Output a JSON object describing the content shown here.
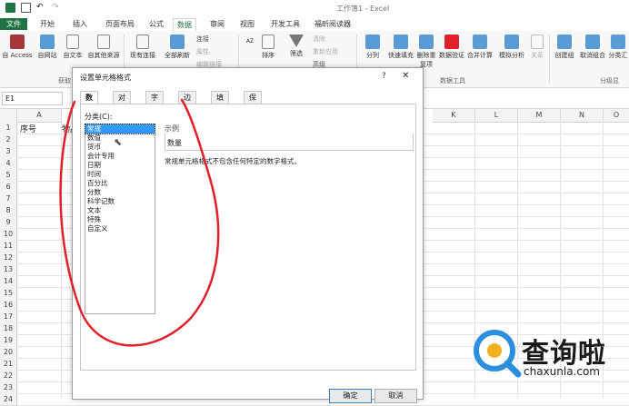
{
  "window": {
    "title": "工作簿1 - Excel"
  },
  "tabs": {
    "file": "文件",
    "items": [
      "开始",
      "插入",
      "页面布局",
      "公式",
      "数据",
      "审阅",
      "视图",
      "开发工具",
      "福昕阅读器"
    ],
    "active": "数据"
  },
  "ribbon": {
    "buttons": [
      "自 Access",
      "自网站",
      "自文本",
      "自其他来源",
      "现有连接",
      "全部刷新",
      "排序",
      "筛选",
      "分列",
      "快速填充",
      "删除重复项",
      "数据验证",
      "合并计算",
      "模拟分析",
      "关系",
      "创建组",
      "取消组合",
      "分类汇"
    ],
    "small_conn": [
      "连接",
      "属性",
      "编辑链接"
    ],
    "small_filter": [
      "清除",
      "重新应用",
      "高级"
    ],
    "groups": [
      "获取",
      "数据工具",
      "分级显"
    ]
  },
  "formula_bar": {
    "name_box": "E1"
  },
  "grid": {
    "columns": [
      "A",
      "K",
      "L",
      "M",
      "N",
      "O"
    ],
    "rows": [
      "1",
      "2",
      "3",
      "4",
      "5",
      "6",
      "7",
      "8",
      "9",
      "10",
      "11",
      "12",
      "13",
      "14",
      "15",
      "16",
      "17",
      "18",
      "19",
      "20",
      "21",
      "22",
      "23",
      "24"
    ],
    "cells": {
      "A1": "序号",
      "B1": "物品"
    }
  },
  "dialog": {
    "title": "设置单元格格式",
    "help": "?",
    "close": "✕",
    "tabs": [
      "数字",
      "对齐",
      "字体",
      "边框",
      "填充",
      "保护"
    ],
    "active_tab": "数字",
    "category_label": "分类(C):",
    "categories": [
      "常规",
      "数值",
      "货币",
      "会计专用",
      "日期",
      "时间",
      "百分比",
      "分数",
      "科学记数",
      "文本",
      "特殊",
      "自定义"
    ],
    "selected_category": "常规",
    "sample_label": "示例",
    "sample_value": "数量",
    "description": "常规单元格格式不包含任何特定的数字格式。",
    "ok_label": "确定",
    "cancel_label": "取消"
  },
  "watermark": {
    "text": "查询啦",
    "domain": "chaxunla.com"
  },
  "colors": {
    "excel_green": "#217346",
    "annotation_red": "#e0202a",
    "selection_blue": "#3399ff"
  }
}
